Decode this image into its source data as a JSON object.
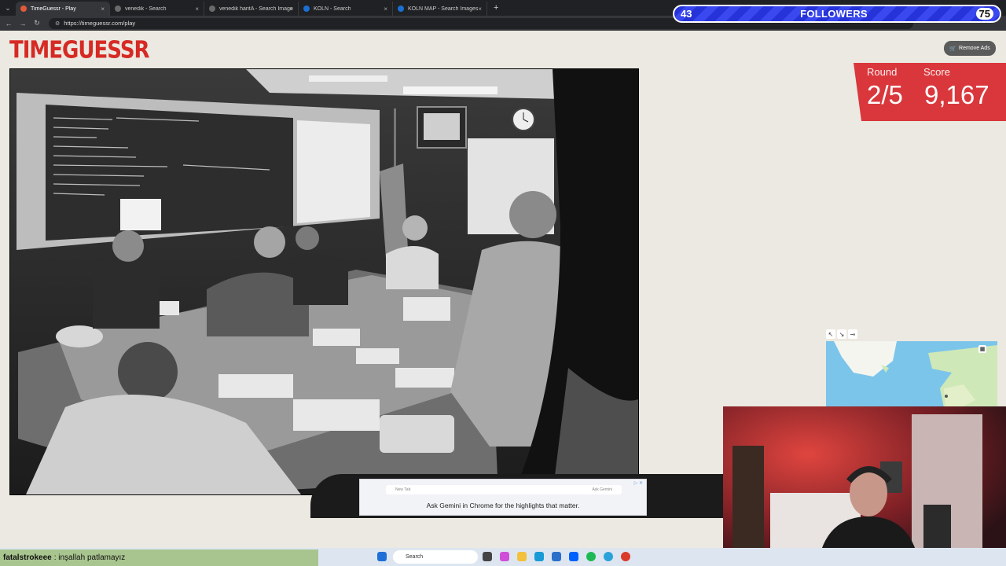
{
  "browser": {
    "tabs": [
      {
        "label": "TimeGuessr - Play",
        "active": true
      },
      {
        "label": "venedik - Search",
        "active": false
      },
      {
        "label": "venedik haritA - Search Images",
        "active": false
      },
      {
        "label": "KOLN - Search",
        "active": false
      },
      {
        "label": "KOLN MAP - Search Images",
        "active": false
      }
    ],
    "url": "https://timeguessr.com/play"
  },
  "followers": {
    "count": "43",
    "label": "FOLLOWERS",
    "goal": "75"
  },
  "site": {
    "logo": "TIMEGUESSR",
    "remove_ads": "Remove Ads"
  },
  "game": {
    "round_label": "Round",
    "round_value": "2/5",
    "score_label": "Score",
    "score_value": "9,167"
  },
  "ad": {
    "text": "Ask Gemini in Chrome for the highlights that matter.",
    "mini": "New Tab",
    "mini2": "Ask Gemini"
  },
  "chat": {
    "user": "fatalstrokeee",
    "message": ": inşallah patlamayız"
  },
  "taskbar": {
    "search_placeholder": "Search"
  },
  "colors": {
    "brand_red": "#d62a24",
    "score_bg": "#d9373c",
    "followers_bg": "#2633d8"
  }
}
